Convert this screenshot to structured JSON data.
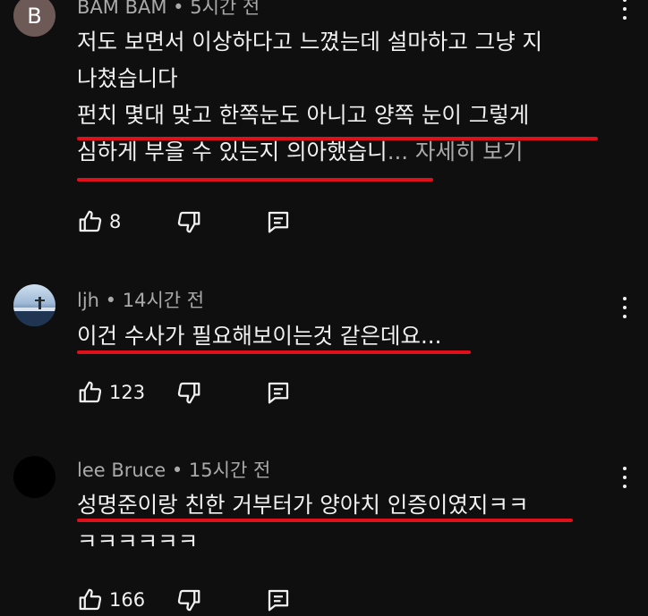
{
  "comments": [
    {
      "avatar_letter": "B",
      "author": "BAM BAM",
      "time": "5시간 전",
      "lines": [
        "저도 보면서 이상하다고 느꼈는데 설마하고 그냥 지",
        "나쳤습니다",
        "펀치 몇대 맞고 한쪽눈도 아니고 양쪽 눈이 그렇게",
        "심하게 부을 수 있는지 의아했습니"
      ],
      "more_label": "... 자세히 보기",
      "likes": "8"
    },
    {
      "author": "ljh",
      "time": "14시간 전",
      "lines": [
        "이건 수사가 필요해보이는것 같은데요..."
      ],
      "likes": "123"
    },
    {
      "author": "lee Bruce",
      "time": "15시간 전",
      "lines": [
        "성명준이랑 친한 거부터가 양아치 인증이였지ㅋㅋ",
        "ㅋㅋㅋㅋㅋㅋ"
      ],
      "likes": "166"
    }
  ],
  "icons": {
    "like": "thumbs-up-icon",
    "dislike": "thumbs-down-icon",
    "reply": "reply-icon",
    "more": "more-vertical-icon"
  },
  "colors": {
    "background": "#0f0f0f",
    "text": "#f1f1f1",
    "meta": "#aaaaaa",
    "underline": "#e0101a"
  }
}
